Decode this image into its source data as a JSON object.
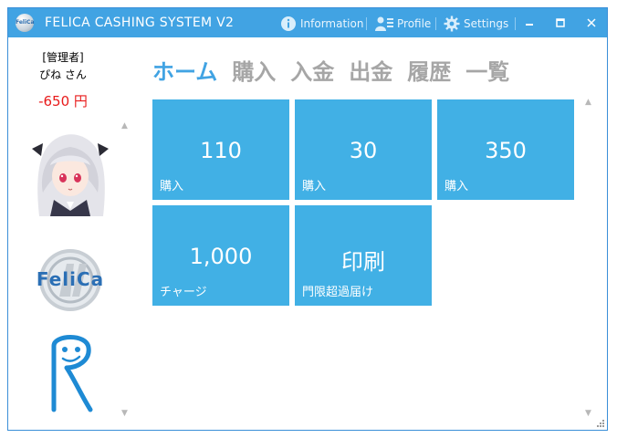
{
  "window": {
    "logo_text": "FeliCa",
    "title": "FELICA CASHING SYSTEM V2",
    "links": {
      "information": "Information",
      "profile": "Profile",
      "settings": "Settings"
    }
  },
  "sidebar": {
    "role": "[管理者]",
    "user": "ぴね さん",
    "balance": "-650 円"
  },
  "nav": {
    "items": [
      "ホーム",
      "購入",
      "入金",
      "出金",
      "履歴",
      "一覧"
    ],
    "active": "ホーム"
  },
  "tiles": [
    {
      "value": "110",
      "label": "購入"
    },
    {
      "value": "30",
      "label": "購入"
    },
    {
      "value": "350",
      "label": "購入"
    },
    {
      "value": "1,000",
      "label": "チャージ"
    },
    {
      "value": "印刷",
      "label": "門限超過届け"
    }
  ],
  "colors": {
    "accent": "#41a3e3",
    "tile": "#41b0e5",
    "balance_negative": "#e81b1b",
    "nav_inactive": "#a6a6a6"
  },
  "icons": {
    "information": "info-icon",
    "profile": "profile-icon",
    "settings": "gear-icon",
    "minimize": "minimize-icon",
    "maximize": "maximize-icon",
    "close": "close-icon"
  }
}
